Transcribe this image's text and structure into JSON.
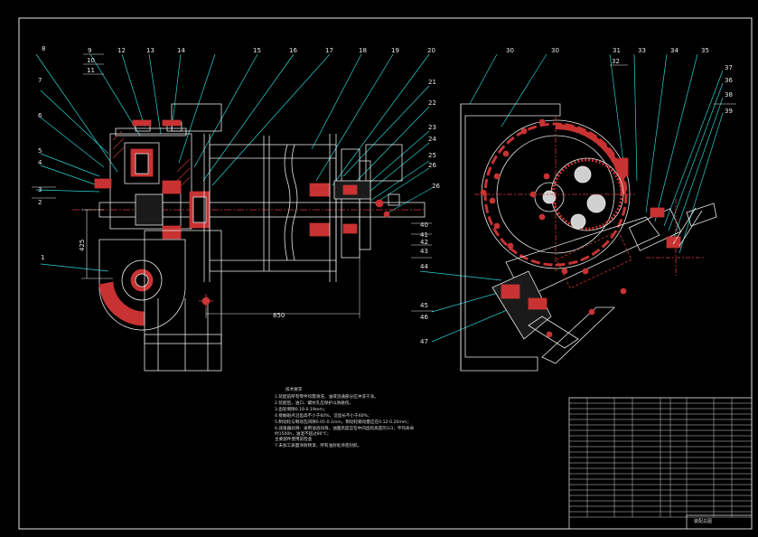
{
  "drawing": {
    "part_labels_left": [
      "8",
      "9",
      "10",
      "11",
      "12",
      "13",
      "14",
      "15",
      "16",
      "17",
      "18",
      "19",
      "20",
      "21",
      "22",
      "23",
      "24",
      "25",
      "26",
      "26",
      "7",
      "6",
      "5",
      "4",
      "3",
      "2",
      "1"
    ],
    "part_labels_right": [
      "30",
      "30",
      "31",
      "32",
      "33",
      "34",
      "35",
      "37",
      "36",
      "38",
      "39",
      "40",
      "41",
      "42",
      "43",
      "44",
      "45",
      "46",
      "47"
    ],
    "dimensions": {
      "vertical": "425",
      "horizontal": "850"
    }
  },
  "notes": {
    "title": "技术要求",
    "lines": [
      "1.装配前所有零件均需清洗，油液流通部分应冲洗干净。",
      "2.装配后，油口、螺纹孔应保护以防碰伤。",
      "3.齿轮侧隙0.16-0.19mm；",
      "4.接触斑点沿齿高不小于60%，沿齿长不小于60%；",
      "5.制动轮与制动瓦间隙0.05-0.1mm，制动轮跳动量应在0.12-0.20mm；",
      "6.减速器润滑：采用油浴润滑，油面高度应在中间齿轮高度的1/3，平均寿命",
      "  约1500h，油温不超过80℃；",
      "  主要部件使用前检查",
      "7.未加工表面涂防锈漆，所有油封处涂密封胶。"
    ]
  },
  "title_block": {
    "name": "装配总图"
  }
}
